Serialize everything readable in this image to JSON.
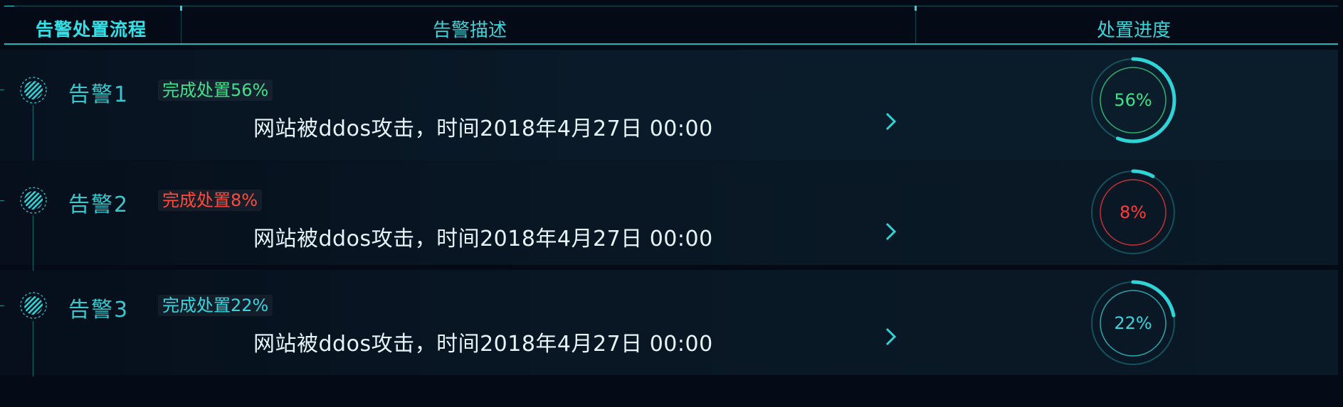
{
  "header": {
    "title": "告警处置流程",
    "col_description": "告警描述",
    "col_progress": "处置进度"
  },
  "alerts": [
    {
      "label": "告警1",
      "badge": "完成处置56%",
      "description": "网站被ddos攻击，时间2018年4月27日 00:00",
      "progress": 56,
      "progress_text": "56%",
      "color": "#3ee28a"
    },
    {
      "label": "告警2",
      "badge": "完成处置8%",
      "description": "网站被ddos攻击，时间2018年4月27日 00:00",
      "progress": 8,
      "progress_text": "8%",
      "color": "#ff3b3b"
    },
    {
      "label": "告警3",
      "badge": "完成处置22%",
      "description": "网站被ddos攻击，时间2018年4月27日 00:00",
      "progress": 22,
      "progress_text": "22%",
      "color": "#36d6de"
    }
  ],
  "icons": {
    "alert_dot": "striped-dot-icon",
    "expand": "chevron-right-icon"
  },
  "colors": {
    "accent": "#2fd4d6",
    "background": "#040b17"
  }
}
